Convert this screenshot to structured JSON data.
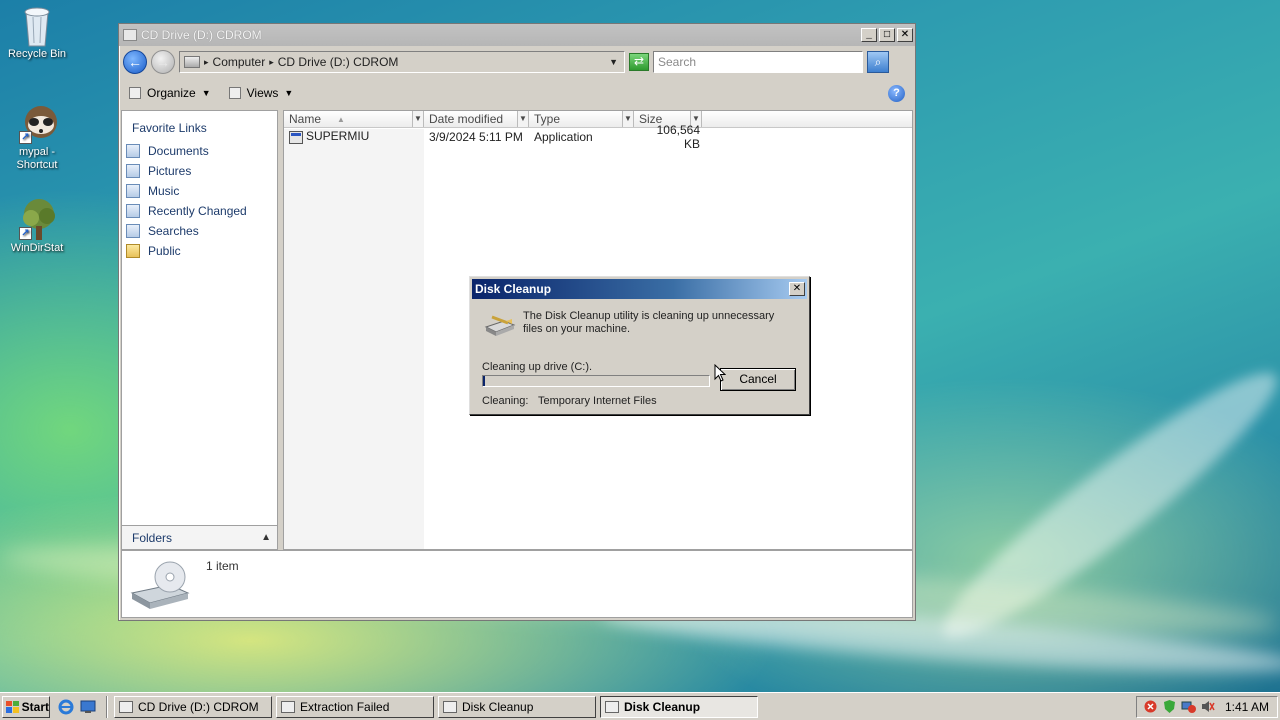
{
  "desktop": {
    "icons": [
      {
        "label": "Recycle Bin",
        "icon": "recycle-bin-icon"
      },
      {
        "label": "mypal - Shortcut",
        "icon": "raccoon-icon"
      },
      {
        "label": "WinDirStat",
        "icon": "tree-icon"
      }
    ]
  },
  "explorer": {
    "title": "CD Drive (D:) CDROM",
    "controls": {
      "minimize": "_",
      "maximize": "□",
      "close": "✕"
    },
    "address": {
      "crumb_root": "Computer",
      "crumb_current": "CD Drive (D:) CDROM"
    },
    "search": {
      "placeholder": "Search"
    },
    "toolbar": {
      "organize": "Organize",
      "views": "Views"
    },
    "nav": {
      "favorites_title": "Favorite Links",
      "items": [
        "Documents",
        "Pictures",
        "Music",
        "Recently Changed",
        "Searches",
        "Public"
      ],
      "folders_label": "Folders"
    },
    "columns": [
      "Name",
      "Date modified",
      "Type",
      "Size"
    ],
    "files": [
      {
        "name": "SUPERMIU",
        "date": "3/9/2024 5:11 PM",
        "type": "Application",
        "size": "106,564 KB"
      }
    ],
    "details": {
      "count": "1 item"
    }
  },
  "dialog": {
    "title": "Disk Cleanup",
    "message": "The Disk Cleanup utility is cleaning up unnecessary files on your machine.",
    "progress_label": "Cleaning up drive  (C:).",
    "progress_fraction": 0.01,
    "status_label": "Cleaning:",
    "status_value": "Temporary Internet Files",
    "cancel": "Cancel"
  },
  "taskbar": {
    "start": "Start",
    "tasks": [
      {
        "label": "CD Drive (D:) CDROM",
        "active": false
      },
      {
        "label": "Extraction Failed",
        "active": false
      },
      {
        "label": "Disk Cleanup",
        "active": false
      },
      {
        "label": "Disk Cleanup",
        "active": true
      }
    ],
    "clock": "1:41 AM"
  },
  "colors": {
    "title_active_start": "#0a246a",
    "title_active_end": "#a6caf0",
    "link_text": "#1d3b6b"
  }
}
